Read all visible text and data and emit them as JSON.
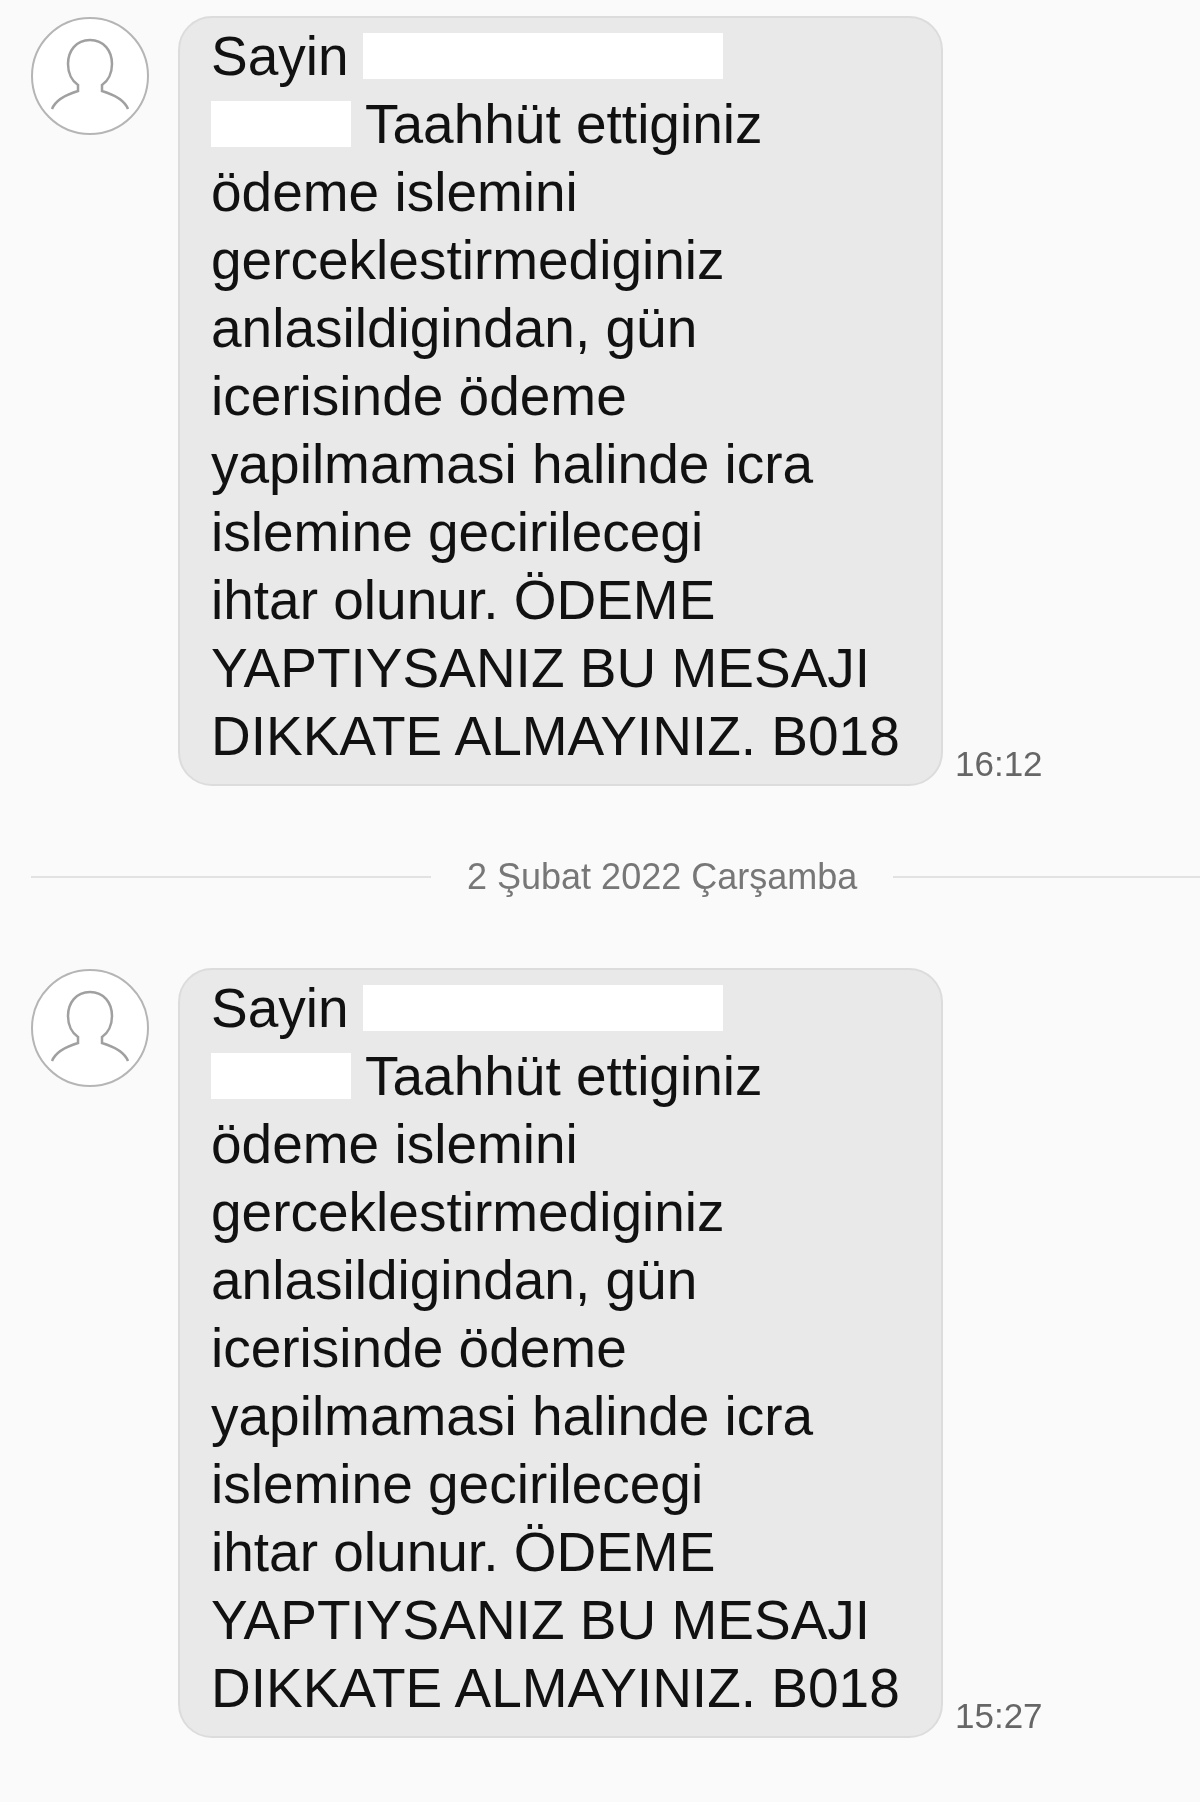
{
  "messages": [
    {
      "lines": [
        [
          {
            "kind": "text",
            "text": "Sayin"
          },
          {
            "kind": "redacted"
          }
        ],
        [
          {
            "kind": "redacted"
          },
          {
            "kind": "text",
            "text": "Taahhüt ettiginiz"
          }
        ],
        [
          {
            "kind": "text",
            "text": "ödeme islemini"
          }
        ],
        [
          {
            "kind": "text",
            "text": "gerceklestirmediginiz"
          }
        ],
        [
          {
            "kind": "text",
            "text": "anlasildigindan, gün"
          }
        ],
        [
          {
            "kind": "text",
            "text": "icerisinde ödeme"
          }
        ],
        [
          {
            "kind": "text",
            "text": "yapilmamasi halinde icra"
          }
        ],
        [
          {
            "kind": "text",
            "text": "islemine gecirilecegi"
          }
        ],
        [
          {
            "kind": "text",
            "text": "ihtar olunur. ÖDEME"
          }
        ],
        [
          {
            "kind": "text",
            "text": "YAPTIYSANIZ BU MESAJI"
          }
        ],
        [
          {
            "kind": "text",
            "text": "DIKKATE ALMAYINIZ. B018"
          }
        ]
      ],
      "time": "16:12"
    },
    {
      "date_before": "2 Şubat 2022 Çarşamba",
      "lines": [
        [
          {
            "kind": "text",
            "text": "Sayin"
          },
          {
            "kind": "redacted"
          }
        ],
        [
          {
            "kind": "redacted"
          },
          {
            "kind": "text",
            "text": "Taahhüt ettiginiz"
          }
        ],
        [
          {
            "kind": "text",
            "text": "ödeme islemini"
          }
        ],
        [
          {
            "kind": "text",
            "text": "gerceklestirmediginiz"
          }
        ],
        [
          {
            "kind": "text",
            "text": "anlasildigindan, gün"
          }
        ],
        [
          {
            "kind": "text",
            "text": "icerisinde ödeme"
          }
        ],
        [
          {
            "kind": "text",
            "text": "yapilmamasi halinde icra"
          }
        ],
        [
          {
            "kind": "text",
            "text": "islemine gecirilecegi"
          }
        ],
        [
          {
            "kind": "text",
            "text": "ihtar olunur. ÖDEME"
          }
        ],
        [
          {
            "kind": "text",
            "text": "YAPTIYSANIZ BU MESAJI"
          }
        ],
        [
          {
            "kind": "text",
            "text": "DIKKATE ALMAYINIZ. B018"
          }
        ]
      ],
      "time": "15:27"
    }
  ]
}
